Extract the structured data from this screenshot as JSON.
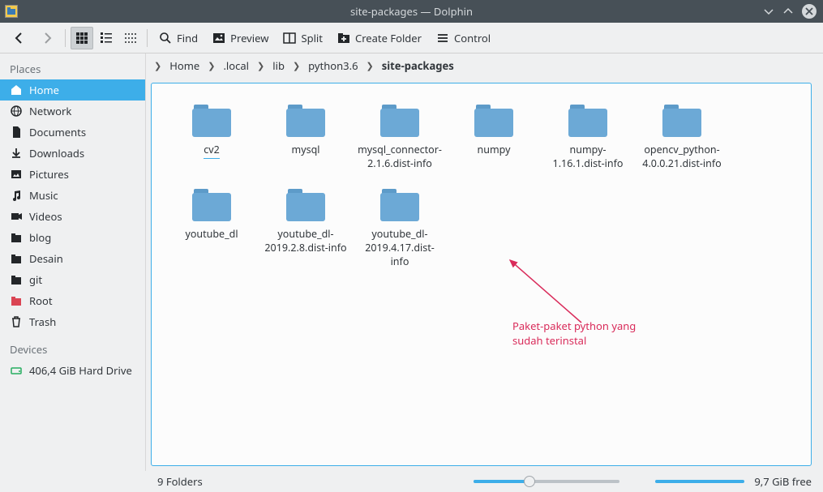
{
  "window": {
    "title": "site-packages — Dolphin"
  },
  "toolbar": {
    "find": "Find",
    "preview": "Preview",
    "split": "Split",
    "create_folder": "Create Folder",
    "control": "Control"
  },
  "sidebar": {
    "places_header": "Places",
    "devices_header": "Devices",
    "items": [
      {
        "label": "Home",
        "icon": "home",
        "selected": true
      },
      {
        "label": "Network",
        "icon": "network"
      },
      {
        "label": "Documents",
        "icon": "doc"
      },
      {
        "label": "Downloads",
        "icon": "download"
      },
      {
        "label": "Pictures",
        "icon": "pictures"
      },
      {
        "label": "Music",
        "icon": "music"
      },
      {
        "label": "Videos",
        "icon": "video"
      },
      {
        "label": "blog",
        "icon": "folder"
      },
      {
        "label": "Desain",
        "icon": "folder"
      },
      {
        "label": "git",
        "icon": "folder"
      },
      {
        "label": "Root",
        "icon": "root"
      },
      {
        "label": "Trash",
        "icon": "trash"
      }
    ],
    "devices": [
      {
        "label": "406,4 GiB Hard Drive",
        "icon": "drive"
      }
    ]
  },
  "breadcrumb": [
    {
      "label": "Home"
    },
    {
      "label": ".local"
    },
    {
      "label": "lib"
    },
    {
      "label": "python3.6"
    },
    {
      "label": "site-packages",
      "current": true
    }
  ],
  "files": [
    {
      "name": "cv2",
      "selected": true
    },
    {
      "name": "mysql"
    },
    {
      "name": "mysql_connector-2.1.6.dist-info"
    },
    {
      "name": "numpy"
    },
    {
      "name": "numpy-1.16.1.dist-info"
    },
    {
      "name": "opencv_python-4.0.0.21.dist-info"
    },
    {
      "name": "youtube_dl"
    },
    {
      "name": "youtube_dl-2019.2.8.dist-info"
    },
    {
      "name": "youtube_dl-2019.4.17.dist-info"
    }
  ],
  "annotation": {
    "line1": "Paket-paket python yang",
    "line2": "sudah terinstal"
  },
  "status": {
    "summary": "9 Folders",
    "free": "9,7 GiB free"
  }
}
